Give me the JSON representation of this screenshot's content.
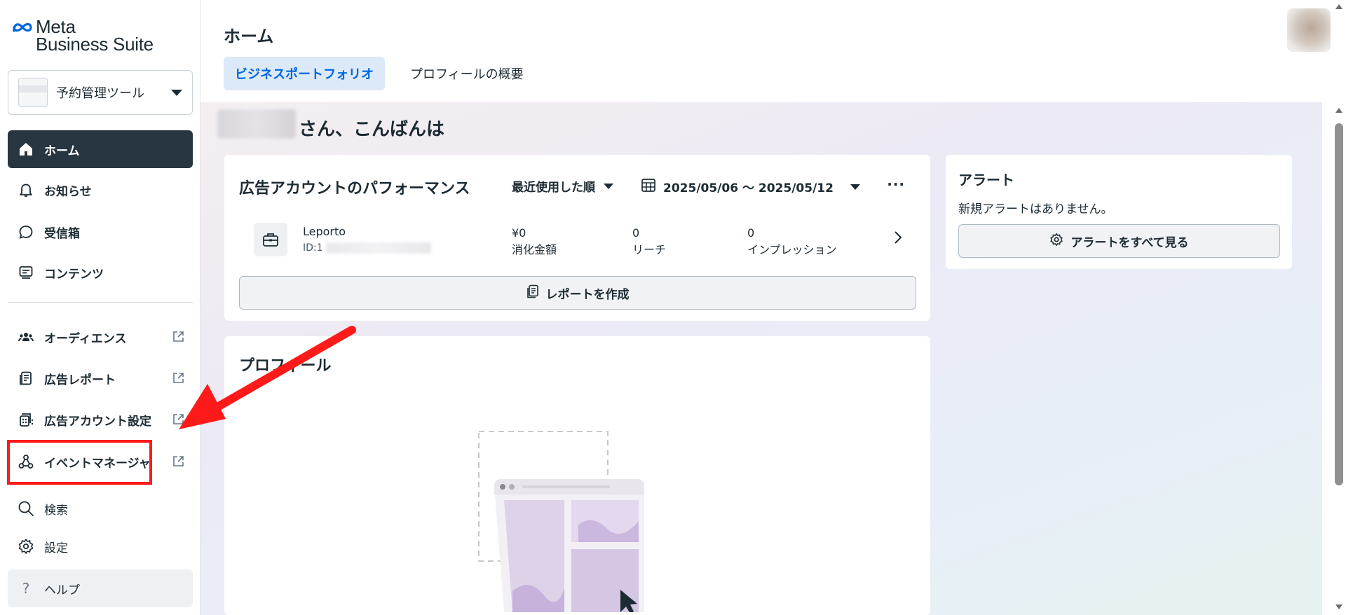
{
  "brand": {
    "line1": "Meta",
    "line2": "Business Suite",
    "accent": "#0064e0"
  },
  "account": {
    "name": "予約管理ツール"
  },
  "nav": {
    "home": "ホーム",
    "notifications": "お知らせ",
    "inbox": "受信箱",
    "content": "コンテンツ",
    "audience": "オーディエンス",
    "ad_report": "広告レポート",
    "ad_account_settings": "広告アカウント設定",
    "events_manager": "イベントマネージャ",
    "search": "検索",
    "settings": "設定",
    "help": "ヘルプ"
  },
  "header": {
    "title": "ホーム",
    "tabs": [
      {
        "label": "ビジネスポートフォリオ",
        "active": true
      },
      {
        "label": "プロフィールの概要",
        "active": false
      }
    ]
  },
  "greeting": "さん、こんばんは",
  "performance": {
    "title": "広告アカウントのパフォーマンス",
    "sort_label": "最近使用した順",
    "date_range": "2025/05/06 〜 2025/05/12",
    "account_name": "Leporto",
    "account_id_prefix": "ID:1",
    "metrics": [
      {
        "value": "¥0",
        "label": "消化金額"
      },
      {
        "value": "0",
        "label": "リーチ"
      },
      {
        "value": "0",
        "label": "インプレッション"
      }
    ],
    "report_button": "レポートを作成"
  },
  "alerts": {
    "title": "アラート",
    "message": "新規アラートはありません。",
    "button": "アラートをすべて見る"
  },
  "profile": {
    "title": "プロフィール"
  },
  "annotation": {
    "color": "#ff1a1a"
  }
}
